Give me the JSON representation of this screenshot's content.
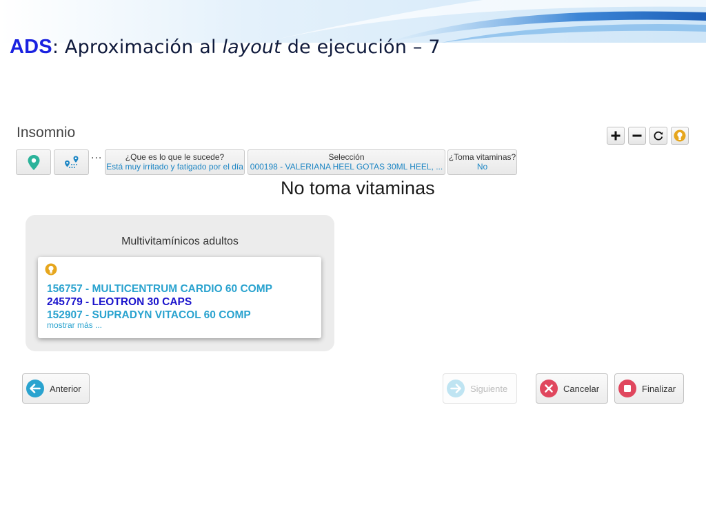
{
  "slide": {
    "title_ads": "ADS",
    "title_colon": ":",
    "title_pre": " Aproximación al ",
    "title_em": "layout",
    "title_post": " de ejecución – 7"
  },
  "app": {
    "title": "Insomnio"
  },
  "toolbar": {
    "buttons": [
      {
        "icon": "plus-icon"
      },
      {
        "icon": "minus-icon"
      },
      {
        "icon": "refresh-icon"
      },
      {
        "icon": "lightbulb-icon"
      }
    ]
  },
  "breadcrumbs": {
    "location_icon": "map-pin-icon",
    "route_icon": "route-icon",
    "ellipsis": "...",
    "steps": [
      {
        "question": "¿Que es lo que le sucede?",
        "answer": "Está muy irritado y fatigado por el día"
      },
      {
        "question": "Selección",
        "answer": "000198 - VALERIANA HEEL GOTAS 30ML HEEL, ..."
      },
      {
        "question": "¿Toma vitaminas?",
        "answer": "No"
      }
    ]
  },
  "question": {
    "text": "No toma vitaminas"
  },
  "group": {
    "title": "Multivitamínicos adultos",
    "products": [
      {
        "label": "156757 - MULTICENTRUM CARDIO 60 COMP",
        "selected": false
      },
      {
        "label": "245779 - LEOTRON 30 CAPS",
        "selected": true
      },
      {
        "label": "152907 - SUPRADYN VITACOL 60 COMP",
        "selected": false
      }
    ],
    "show_more": "mostrar más ..."
  },
  "nav": {
    "prev": "Anterior",
    "next": "Siguiente",
    "cancel": "Cancelar",
    "finish": "Finalizar"
  },
  "colors": {
    "ads": "#1a22e0",
    "product_link": "#2aa3cf",
    "product_selected": "#1b14cc",
    "prev_icon": "#2aa3cf",
    "cancel_icon": "#e0475e",
    "finish_icon": "#e0475e",
    "pin_icon": "#2bb39a",
    "bulb_icon": "#e6a61d"
  }
}
